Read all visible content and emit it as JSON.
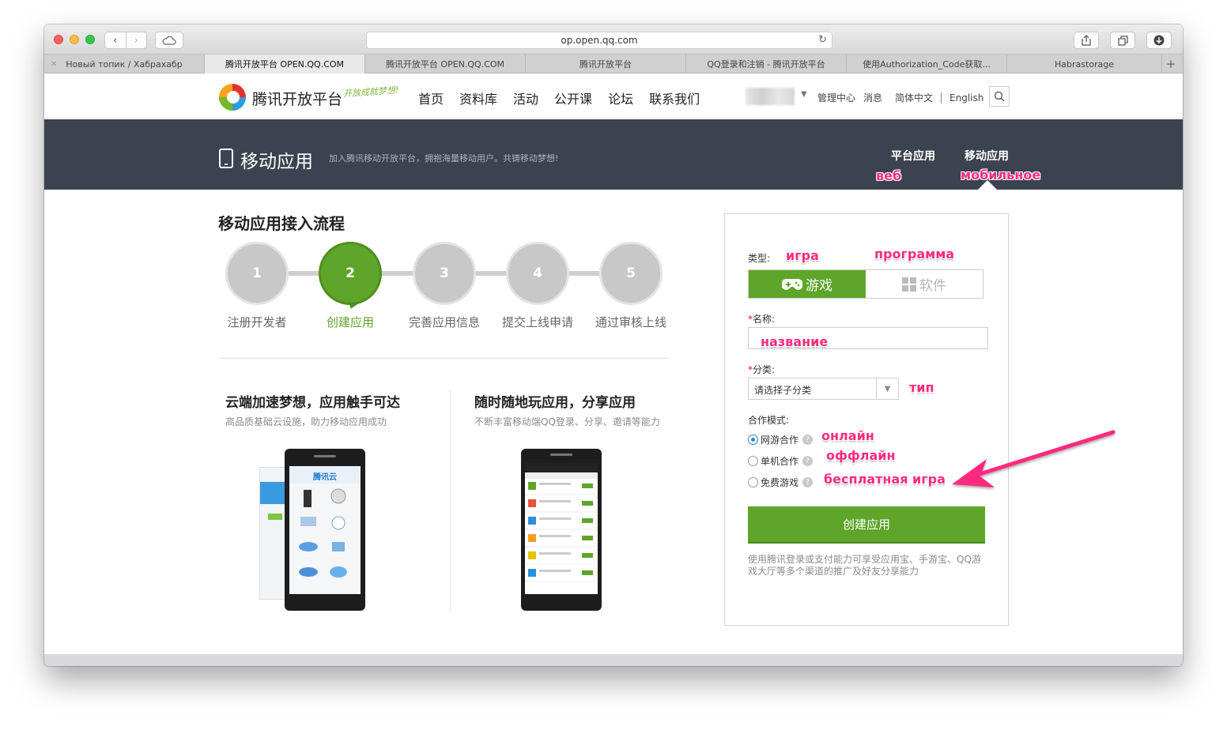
{
  "browser": {
    "url": "op.open.qq.com",
    "tabs": [
      "Новый топик / Хабрахабр",
      "腾讯开放平台 OPEN.QQ.COM",
      "腾讯开放平台 OPEN.QQ.COM",
      "腾讯开放平台",
      "QQ登录和注销 - 腾讯开放平台",
      "使用Authorization_Code获取...",
      "Habrastorage"
    ],
    "active_tab": 1
  },
  "header": {
    "logo_text": "腾讯开放平台",
    "slogan": "开放成就梦想!",
    "nav": [
      "首页",
      "资料库",
      "活动",
      "公开课",
      "论坛",
      "联系我们"
    ],
    "right_links": [
      "管理中心",
      "消息",
      "简体中文",
      "English"
    ]
  },
  "banner": {
    "title": "移动应用",
    "subtitle": "加入腾讯移动开放平台，拥抱海量移动用户。共铸移动梦想!",
    "tab_platform": "平台应用",
    "tab_mobile": "移动应用"
  },
  "flow": {
    "title": "移动应用接入流程",
    "steps": [
      {
        "num": "1",
        "label": "注册开发者"
      },
      {
        "num": "2",
        "label": "创建应用"
      },
      {
        "num": "3",
        "label": "完善应用信息"
      },
      {
        "num": "4",
        "label": "提交上线申请"
      },
      {
        "num": "5",
        "label": "通过审核上线"
      }
    ],
    "active_step": 2
  },
  "features": [
    {
      "title": "云端加速梦想，应用触手可达",
      "subtitle": "高品质基础云设施，助力移动应用成功",
      "phone_brand": "腾讯云"
    },
    {
      "title": "随时随地玩应用，分享应用",
      "subtitle": "不断丰富移动端QQ登录、分享、邀请等能力"
    }
  ],
  "form": {
    "type_label": "类型:",
    "type_game": "游戏",
    "type_software": "软件",
    "name_label": "名称:",
    "name_value": "",
    "category_label": "分类:",
    "category_value": "请选择子分类",
    "mode_label": "合作模式:",
    "modes": [
      "网游合作",
      "单机合作",
      "免费游戏"
    ],
    "selected_mode": 0,
    "submit": "创建应用",
    "note": "使用腾讯登录或支付能力可享受应用宝、手游宝、QQ游戏大厅等多个渠道的推广及好友分享能力"
  },
  "annotations": {
    "web": "веб",
    "mobile": "мобильное",
    "game": "игра",
    "program": "программа",
    "name": "название",
    "type": "тип",
    "online": "онлайн",
    "offline": "оффлайн",
    "free_game": "бесплатная игра"
  },
  "colors": {
    "accent_green": "#5ea52a",
    "banner_bg": "#3c4350",
    "annotation_pink": "#ff2a7f"
  }
}
